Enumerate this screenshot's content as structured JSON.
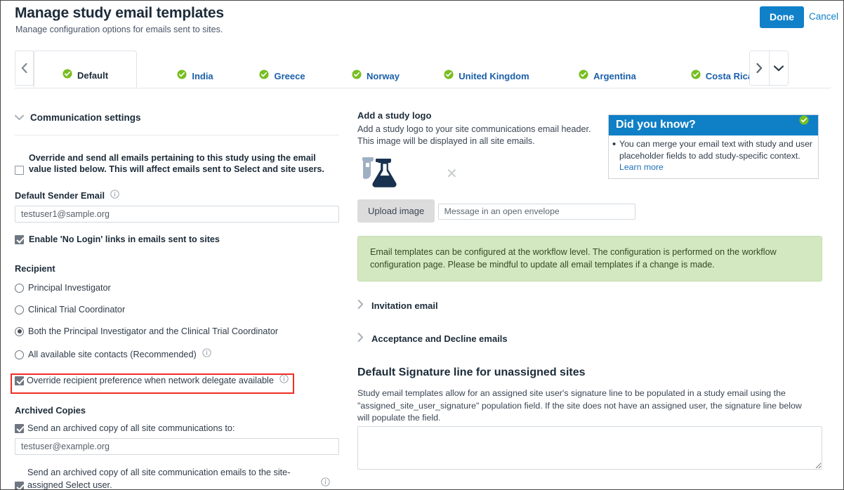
{
  "header": {
    "title": "Manage study email templates",
    "subtitle": "Manage configuration options for emails sent to sites.",
    "done_label": "Done",
    "cancel_label": "Cancel",
    "accent_color": "#1081c9"
  },
  "tabs": {
    "prev_icon": "chevron-left-icon",
    "next_icon": "chevron-right-icon",
    "more_icon": "chevron-down-icon",
    "status_icon": "check-circle-icon",
    "status_color": "#78be20",
    "items": [
      {
        "label": "Default",
        "active": true
      },
      {
        "label": "India",
        "active": false
      },
      {
        "label": "Greece",
        "active": false
      },
      {
        "label": "Norway",
        "active": false
      },
      {
        "label": "United Kingdom",
        "active": false
      },
      {
        "label": "Argentina",
        "active": false
      },
      {
        "label": "Costa Rica",
        "active": false
      }
    ]
  },
  "left": {
    "communication_settings_label": "Communication settings",
    "override_all_emails_label": "Override and send all emails pertaining to this study using the email value listed below. This will affect emails sent to Select and site users.",
    "override_all_emails_checked": false,
    "default_sender_label": "Default Sender Email",
    "default_sender_value": "testuser1@sample.org",
    "no_login_label": "Enable 'No Login' links in emails sent to sites",
    "no_login_checked": true,
    "recipient_title": "Recipient",
    "recipient_options": [
      {
        "label": "Principal Investigator",
        "selected": false,
        "info": false
      },
      {
        "label": "Clinical Trial Coordinator",
        "selected": false,
        "info": false
      },
      {
        "label": "Both the Principal Investigator and the Clinical Trial Coordinator",
        "selected": true,
        "info": false
      },
      {
        "label": "All available site contacts (Recommended)",
        "selected": false,
        "info": true
      }
    ],
    "override_delegate_label": "Override recipient preference when network delegate available",
    "override_delegate_checked": true,
    "highlight_color": "#ee2e24",
    "archived_title": "Archived Copies",
    "archived_copy_label": "Send an archived copy of all site communications to:",
    "archived_copy_checked": true,
    "archived_email_value": "testuser@example.org",
    "archived_site_assigned_label": "Send an archived copy of all site communication emails to the site-assigned Select user.",
    "archived_site_assigned_checked": true
  },
  "right": {
    "logo_title": "Add a study logo",
    "logo_description": "Add a study logo to your site communications email header. This image will be displayed in all site emails.",
    "logo_icon": "lab-flask-icon",
    "logo_clear_icon": "close-icon",
    "upload_label": "Upload image",
    "alt_text_value": "Message in an open envelope",
    "did_you_know": {
      "title": "Did you know?",
      "body_before_link": "You can merge your email text with study and user placeholder fields to add study-specific context. ",
      "link_label": "Learn more",
      "header_color": "#0f7fc6"
    },
    "green_note": "Email templates can be configured at the workflow level. The configuration is performed on the workflow configuration page. Please be mindful to update all email templates if a change is made.",
    "green_note_color": "#d3e8c0",
    "invitation_email_label": "Invitation email",
    "acceptance_decline_label": "Acceptance and Decline emails",
    "signature_title": "Default Signature line for unassigned sites",
    "signature_description": "Study email templates allow for an assigned site user's signature line to be populated in a study email using the \"assigned_site_user_signature\" population field. If the site does not have an assigned user, the signature line below will populate the field.",
    "signature_value": ""
  }
}
